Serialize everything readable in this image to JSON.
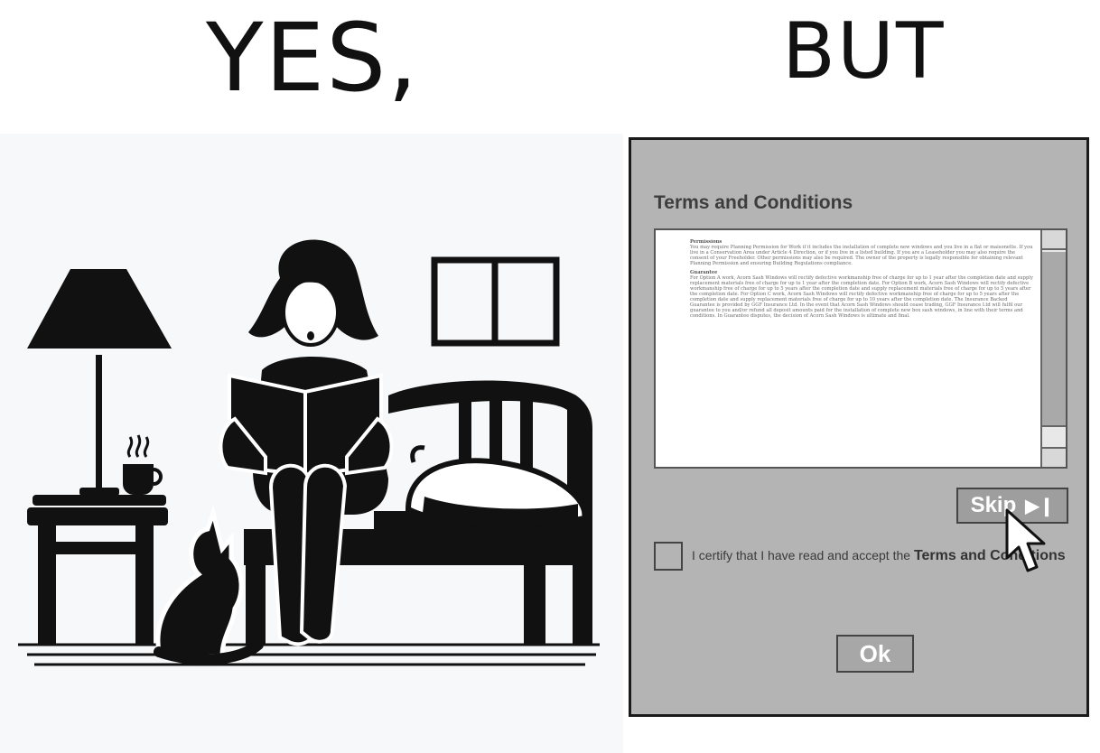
{
  "headings": {
    "left": "YES,",
    "right": "BUT"
  },
  "dialog": {
    "title": "Terms and Conditions",
    "terms": [
      {
        "heading": "Permissions",
        "body": "You may require Planning Permission for Work if it includes the installation of complete new windows and you live in a flat or maisonette. If you live in a Conservation Area under Article 4 Direction, or if you live in a listed building. If you are a Leaseholder you may also require the consent of your Freeholder. Other permissions may also be required. The owner of the property is legally responsible for obtaining relevant Planning Permission and ensuring Building Regulations compliance."
      },
      {
        "heading": "Guarantee",
        "body": "For Option A work, Acorn Sash Windows will rectify defective workmanship free of charge for up to 1 year after the completion date and supply replacement materials free of charge for up to 1 year after the completion date. For Option B work, Acorn Sash Windows will rectify defective workmanship free of charge for up to 5 years after the completion date and supply replacement materials free of charge for up to 5 years after the completion date. For Option C work, Acorn Sash Windows will rectify defective workmanship free of charge for up to 5 years after the completion date and supply replacement materials free of charge for up to 10 years after the completion date. The Insurance Backed Guarantee is provided by GGF Insurance Ltd. In the event that Acorn Sash Windows should cease trading, GGF Insurance Ltd will fulfil our guarantee to you and/or refund all deposit amounts paid for the installation of complete new box sash windows, in line with their terms and conditions. In Guarantee disputes, the decision of Acorn Sash Windows is ultimate and final."
      }
    ],
    "skip_label": "Skip",
    "skip_icon": "skip-forward-icon",
    "certify_prefix": "I certify that I have read and accept the",
    "certify_link": "Terms and Conditions",
    "ok_label": "Ok"
  },
  "colors": {
    "dialog_bg": "#b4b4b4",
    "scroll_thumb": "#a9a9a9",
    "ink": "#111111"
  }
}
